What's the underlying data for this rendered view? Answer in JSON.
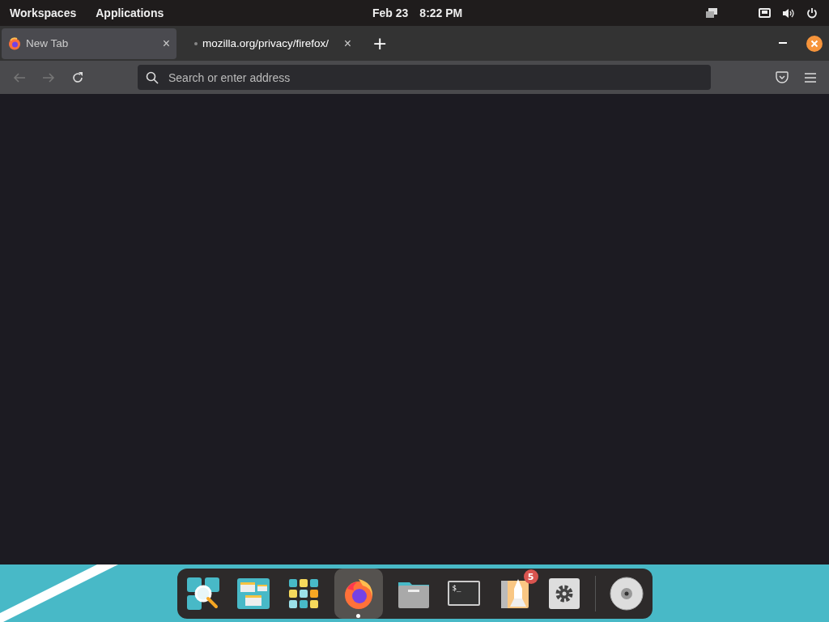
{
  "top_bar": {
    "menus": [
      "Workspaces",
      "Applications"
    ],
    "date": "Feb 23",
    "time": "8:22 PM"
  },
  "tabs": [
    {
      "label": "New Tab",
      "selected": true,
      "close": "×"
    },
    {
      "label": "mozilla.org/privacy/firefox/",
      "selected": false,
      "close": "×"
    }
  ],
  "new_tab": "+",
  "address_bar": {
    "placeholder": "Search or enter address"
  },
  "dock": {
    "items": [
      {
        "kind": "search",
        "running": false
      },
      {
        "kind": "windows",
        "running": false
      },
      {
        "kind": "apps",
        "running": false
      },
      {
        "kind": "firefox",
        "running": true
      },
      {
        "kind": "files",
        "running": false
      },
      {
        "kind": "terminal",
        "running": false,
        "prompt": "$_"
      },
      {
        "kind": "shop",
        "running": false,
        "badge": "5"
      },
      {
        "kind": "settings",
        "running": false
      },
      {
        "kind": "disc",
        "running": false
      }
    ]
  }
}
